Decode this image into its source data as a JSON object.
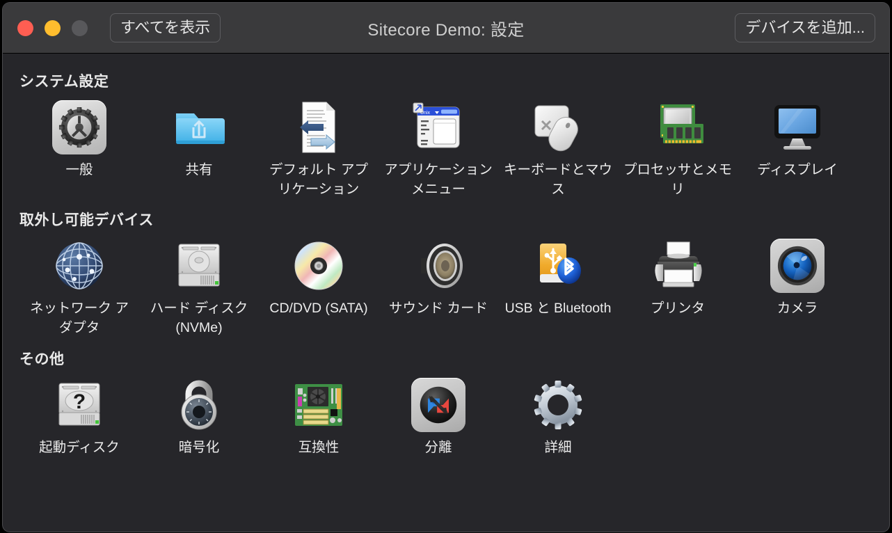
{
  "window": {
    "title": "Sitecore Demo: 設定",
    "traffic_lights": [
      "close",
      "minimize",
      "zoom"
    ],
    "show_all_label": "すべてを表示",
    "add_device_label": "デバイスを追加...",
    "colors": {
      "titlebar": "#3A3A3C",
      "body": "#26262A",
      "close": "#FF5E52",
      "minimize": "#FFBD2E",
      "zoom_disabled": "#58585B",
      "text": "#ECECEC"
    }
  },
  "sections": [
    {
      "id": "system-settings",
      "title": "システム設定",
      "items": [
        {
          "label": "一般",
          "icon": "gear-tile-icon"
        },
        {
          "label": "共有",
          "icon": "shared-folder-icon"
        },
        {
          "label": "デフォルト アプリケーション",
          "icon": "default-applications-icon"
        },
        {
          "label": "アプリケーション メニュー",
          "icon": "application-menu-icon"
        },
        {
          "label": "キーボードとマウス",
          "icon": "keyboard-mouse-icon"
        },
        {
          "label": "プロセッサとメモリ",
          "icon": "processor-memory-icon"
        },
        {
          "label": "ディスプレイ",
          "icon": "display-icon"
        }
      ]
    },
    {
      "id": "removable-devices",
      "title": "取外し可能デバイス",
      "items": [
        {
          "label": "ネットワーク アダプタ",
          "icon": "network-adapter-icon"
        },
        {
          "label": "ハード ディスク (NVMe)",
          "icon": "hard-disk-icon"
        },
        {
          "label": "CD/DVD (SATA)",
          "icon": "cd-dvd-icon"
        },
        {
          "label": "サウンド カード",
          "icon": "sound-card-icon"
        },
        {
          "label": "USB と Bluetooth",
          "icon": "usb-bluetooth-icon"
        },
        {
          "label": "プリンタ",
          "icon": "printer-icon"
        },
        {
          "label": "カメラ",
          "icon": "camera-icon"
        }
      ]
    },
    {
      "id": "other",
      "title": "その他",
      "items": [
        {
          "label": "起動ディスク",
          "icon": "startup-disk-icon"
        },
        {
          "label": "暗号化",
          "icon": "encryption-lock-icon"
        },
        {
          "label": "互換性",
          "icon": "compatibility-board-icon"
        },
        {
          "label": "分離",
          "icon": "isolation-icon"
        },
        {
          "label": "詳細",
          "icon": "advanced-gear-icon"
        }
      ]
    }
  ]
}
